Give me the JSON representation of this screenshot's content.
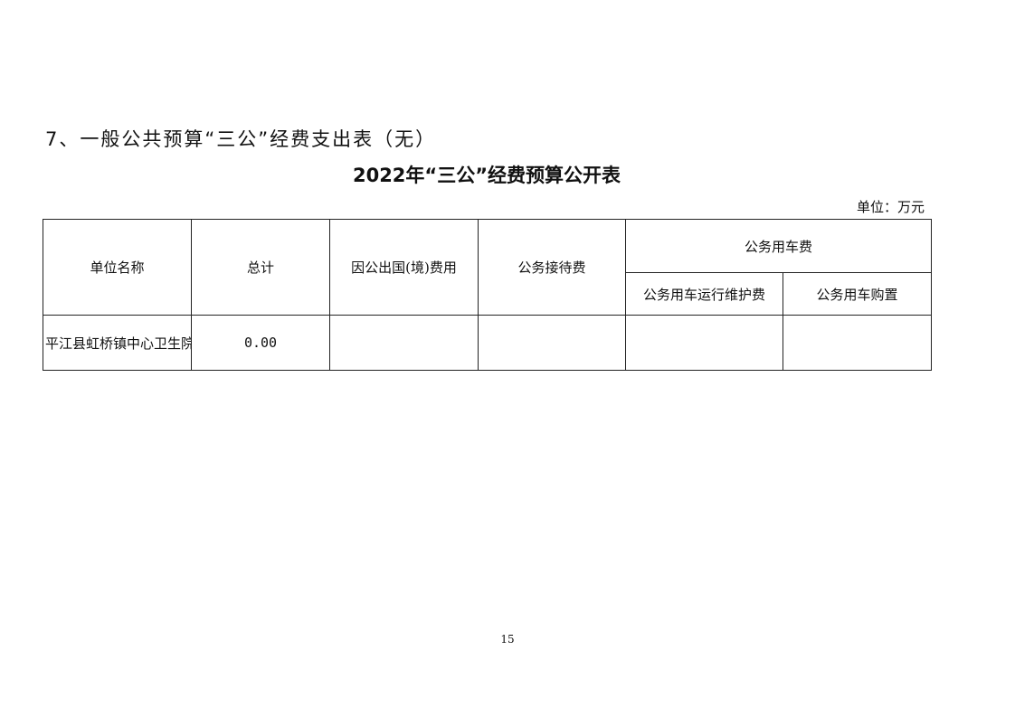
{
  "section_heading": "7、一般公共预算“三公”经费支出表（无）",
  "table_title": "2022年“三公”经费预算公开表",
  "unit_label": "单位：万元",
  "table": {
    "headers": {
      "unit_name": "单位名称",
      "total": "总计",
      "overseas": "因公出国(境)费用",
      "reception": "公务接待费",
      "vehicle_group": "公务用车费",
      "vehicle_operation": "公务用车运行维护费",
      "vehicle_purchase": "公务用车购置"
    },
    "rows": [
      {
        "unit_name": "平江县虹桥镇中心卫生院",
        "total": "0.00",
        "overseas": "",
        "reception": "",
        "vehicle_operation": "",
        "vehicle_purchase": ""
      }
    ]
  },
  "page_number": "15"
}
